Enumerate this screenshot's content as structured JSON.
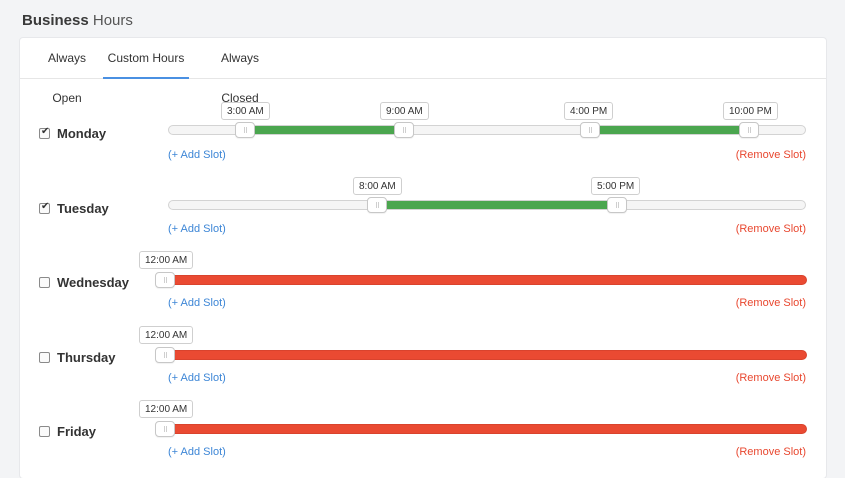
{
  "header": {
    "title_bold": "Business",
    "title_rest": " Hours"
  },
  "tabs": [
    {
      "label": "Always Open",
      "active": false
    },
    {
      "label": "Custom Hours",
      "active": true
    },
    {
      "label": "Always Closed",
      "active": false
    }
  ],
  "actions": {
    "add_slot": "(+ Add Slot)",
    "remove_slot": "(Remove Slot)"
  },
  "days": [
    {
      "name": "Monday",
      "checked": true,
      "slots": [
        {
          "start": "3:00 AM",
          "end": "9:00 AM"
        },
        {
          "start": "4:00 PM",
          "end": "10:00 PM"
        }
      ]
    },
    {
      "name": "Tuesday",
      "checked": true,
      "slots": [
        {
          "start": "8:00 AM",
          "end": "5:00 PM"
        }
      ]
    },
    {
      "name": "Wednesday",
      "checked": false,
      "closed_label": "12:00 AM"
    },
    {
      "name": "Thursday",
      "checked": false,
      "closed_label": "12:00 AM"
    },
    {
      "name": "Friday",
      "checked": false,
      "closed_label": "12:00 AM"
    }
  ],
  "colors": {
    "open": "#4ba64f",
    "closed": "#ea4a32",
    "link": "#3d86d6",
    "remove": "#e8472f",
    "tab_active": "#4a90e2"
  }
}
